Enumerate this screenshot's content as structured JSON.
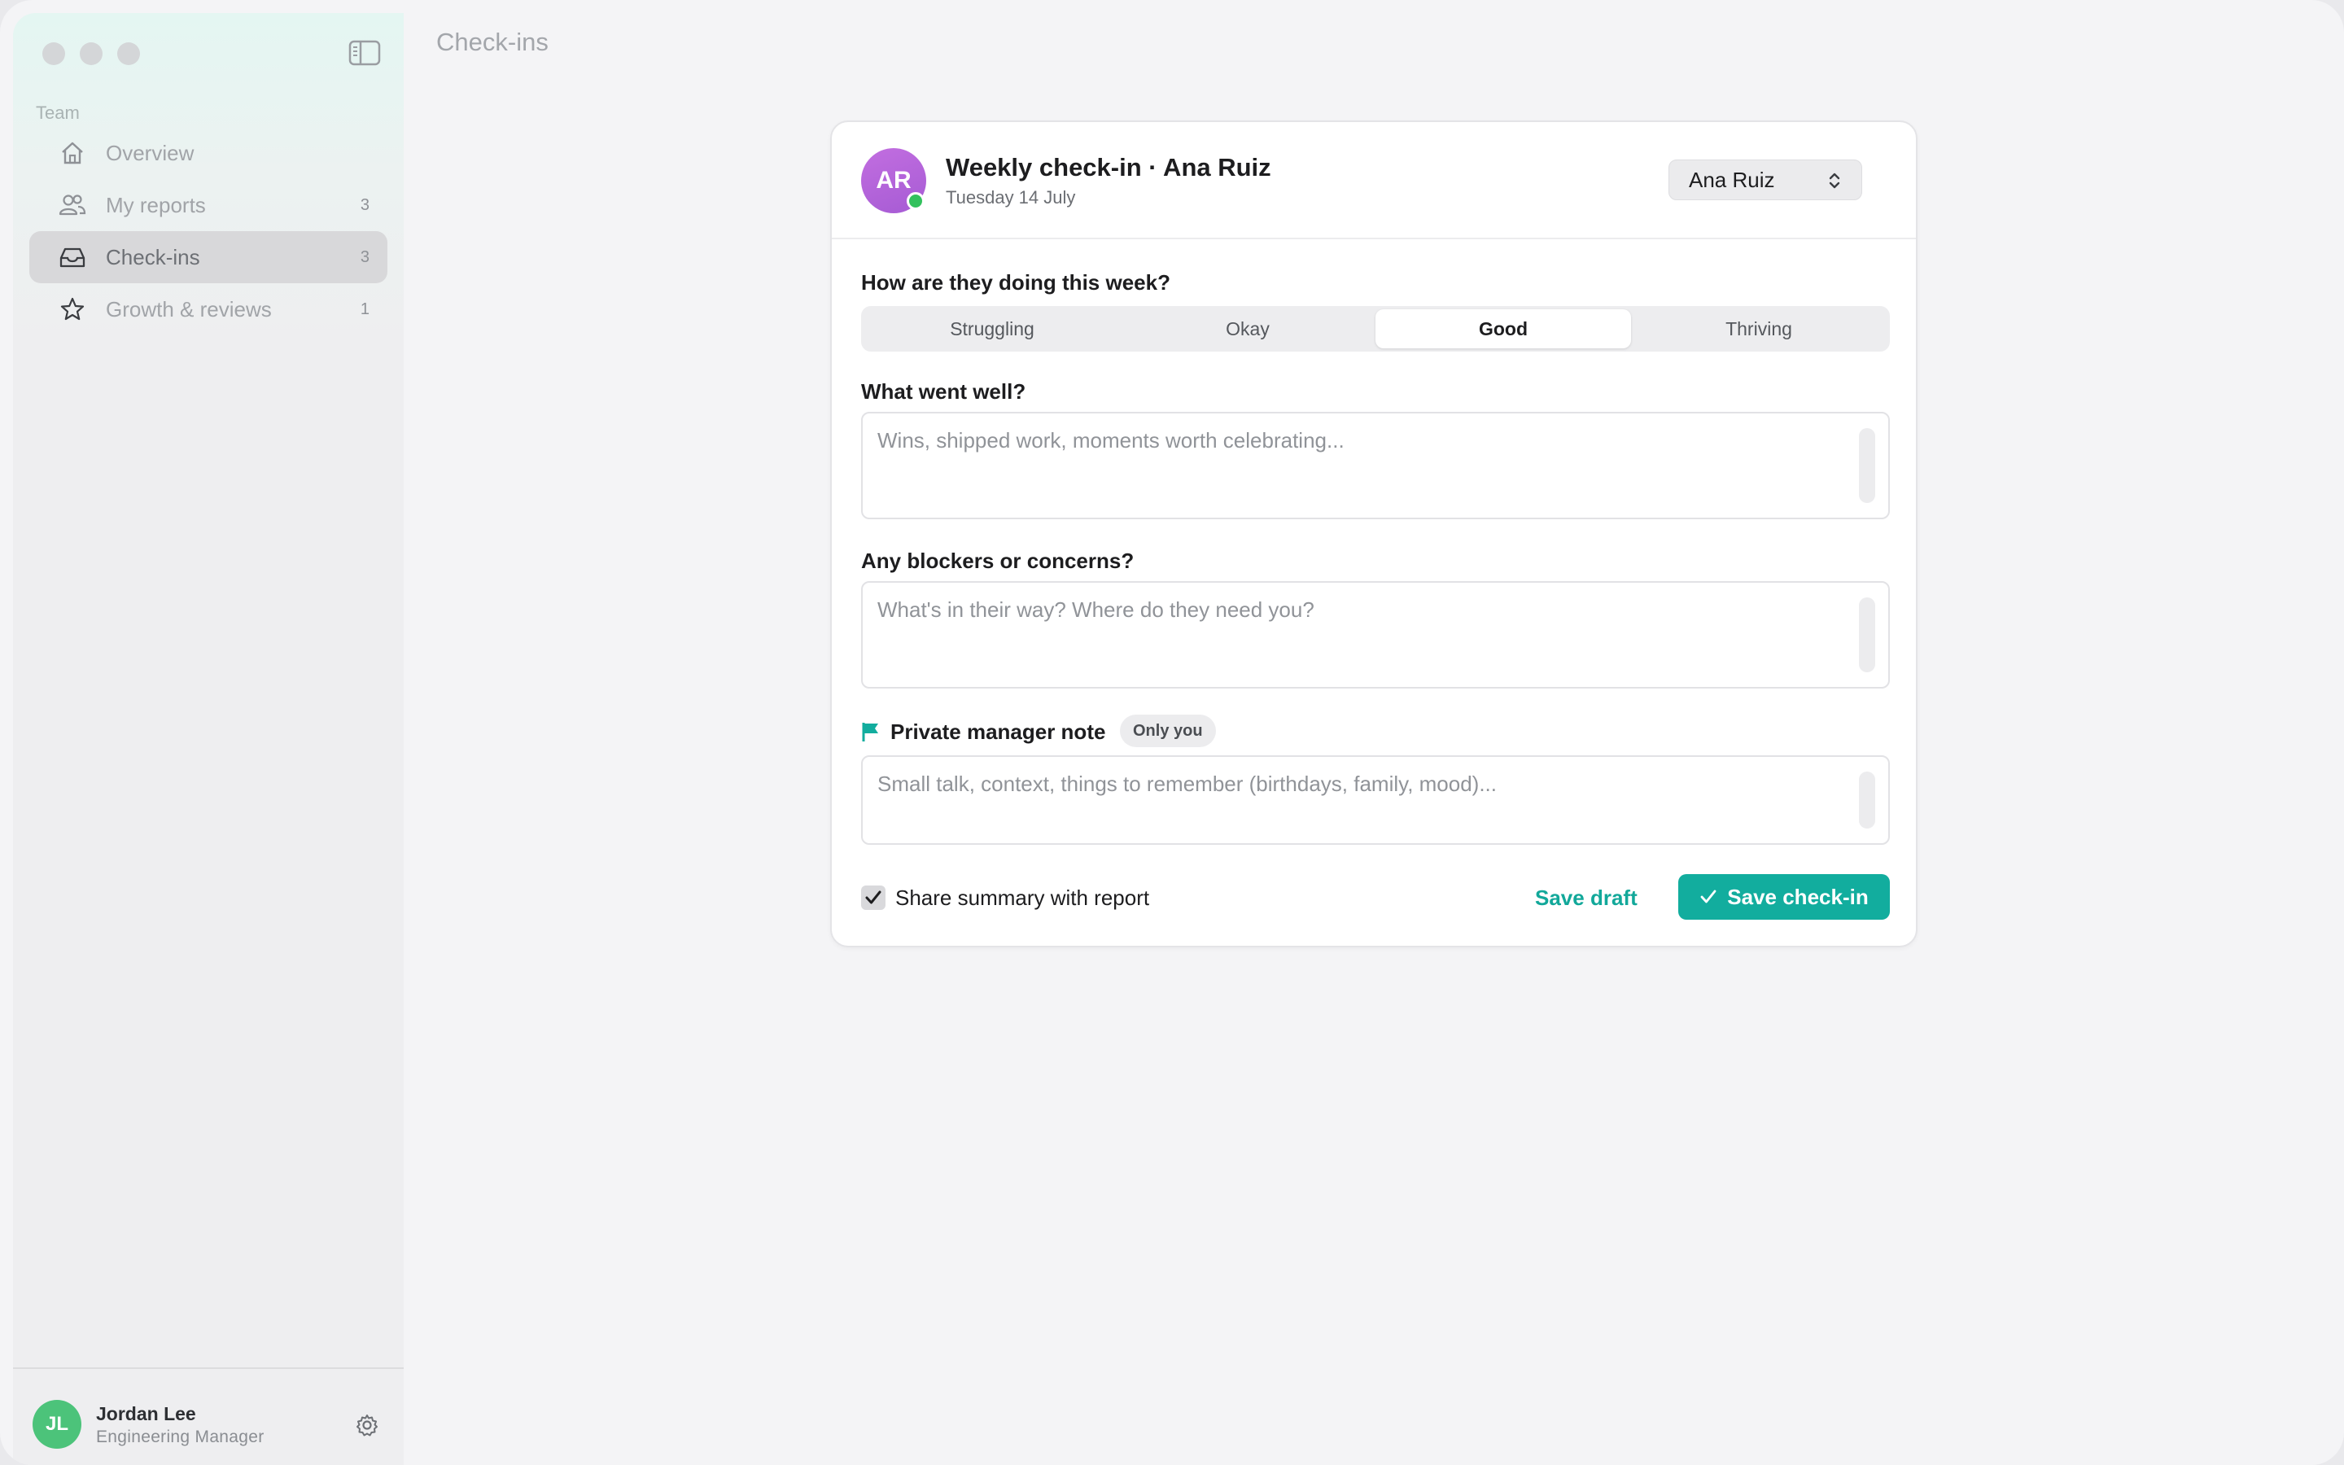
{
  "window": {
    "title": "Check-ins"
  },
  "sidebar": {
    "section_label": "Team",
    "items": [
      {
        "label": "Overview",
        "icon": "home-icon",
        "count": ""
      },
      {
        "label": "My reports",
        "icon": "people-icon",
        "count": "3"
      },
      {
        "label": "Check-ins",
        "icon": "inbox-icon",
        "count": "3",
        "active": true
      },
      {
        "label": "Growth & reviews",
        "icon": "star-icon",
        "count": "1"
      }
    ],
    "user": {
      "initials": "JL",
      "name": "Jordan Lee",
      "role": "Engineering Manager"
    }
  },
  "card": {
    "avatar_initials": "AR",
    "title": "Weekly check-in · Ana Ruiz",
    "date": "Tuesday 14 July",
    "person_select": "Ana Ruiz",
    "mood_question": "How are they doing this week?",
    "mood_options": [
      "Struggling",
      "Okay",
      "Good",
      "Thriving"
    ],
    "mood_selected": "Good",
    "went_well": {
      "label": "What went well?",
      "placeholder": "Wins, shipped work, moments worth celebrating..."
    },
    "blockers": {
      "label": "Any blockers or concerns?",
      "placeholder": "What's in their way? Where do they need you?"
    },
    "private_note": {
      "label": "Private manager note",
      "badge": "Only you",
      "placeholder": "Small talk, context, things to remember (birthdays, family, mood)..."
    },
    "share_label": "Share summary with report",
    "share_checked": true,
    "save_draft": "Save draft",
    "save_checkin": "Save check-in"
  },
  "colors": {
    "accent": "#12ad9e",
    "avatar": "#b865dc",
    "status_online": "#33c15d",
    "user_avatar": "#4cc37a"
  }
}
